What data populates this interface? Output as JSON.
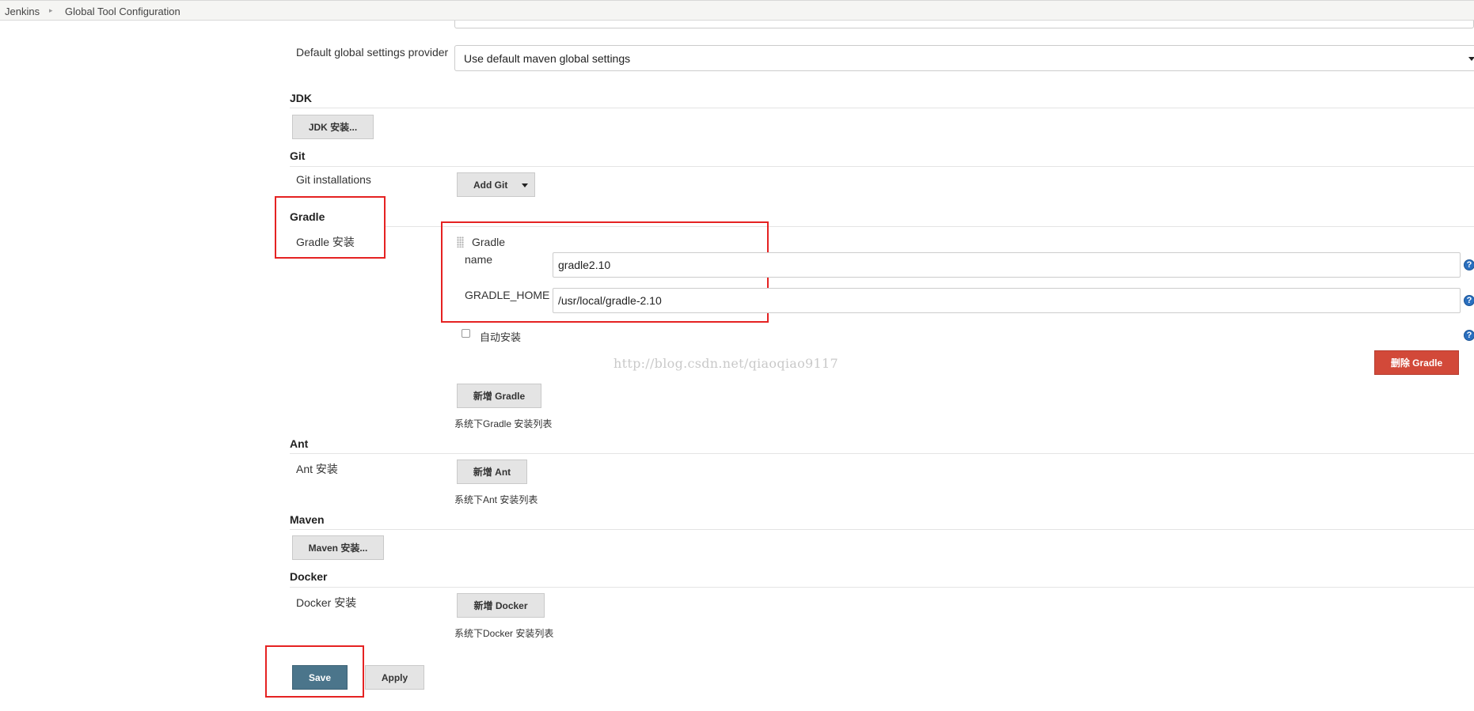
{
  "breadcrumb": {
    "items": [
      "Jenkins",
      "Global Tool Configuration"
    ]
  },
  "maven_settings": {
    "global_settings_label": "Default global settings provider",
    "global_settings_value": "Use default maven global settings"
  },
  "jdk": {
    "header": "JDK",
    "button_label": "JDK 安装..."
  },
  "git": {
    "header": "Git",
    "installations_label": "Git installations",
    "add_button_label": "Add Git"
  },
  "gradle": {
    "header": "Gradle",
    "installations_label": "Gradle 安装",
    "item_title": "Gradle",
    "name_label": "name",
    "name_value": "gradle2.10",
    "home_label": "GRADLE_HOME",
    "home_value": "/usr/local/gradle-2.10",
    "auto_install_label": "自动安装",
    "delete_button_label": "删除 Gradle",
    "add_button_label": "新增 Gradle",
    "list_note": "系统下Gradle 安装列表"
  },
  "watermark": "http://blog.csdn.net/qiaoqiao9117",
  "ant": {
    "header": "Ant",
    "installations_label": "Ant 安装",
    "add_button_label": "新增 Ant",
    "list_note": "系统下Ant 安装列表"
  },
  "maven": {
    "header": "Maven",
    "button_label": "Maven 安装..."
  },
  "docker": {
    "header": "Docker",
    "installations_label": "Docker 安装",
    "add_button_label": "新增 Docker",
    "list_note": "系统下Docker 安装列表"
  },
  "footer": {
    "save_label": "Save",
    "apply_label": "Apply"
  },
  "help_glyph": "?",
  "colors": {
    "danger": "#d24939",
    "primary": "#4b758b",
    "annotation": "#e52222",
    "help": "#2a6fbf"
  }
}
